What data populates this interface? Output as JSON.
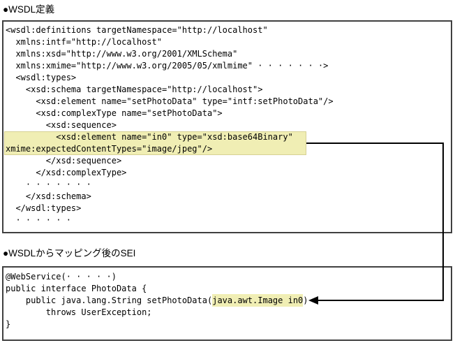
{
  "headings": {
    "wsdl": "●WSDL定義",
    "sei": "●WSDLからマッピング後のSEI"
  },
  "wsdl_box": {
    "lines": [
      "<wsdl:definitions targetNamespace=\"http://localhost\"",
      "  xmlns:intf=\"http://localhost\"",
      "  xmlns:xsd=\"http://www.w3.org/2001/XMLSchema\"",
      "  xmlns:xmime=\"http://www.w3.org/2005/05/xmlmime\" · · · · · · ·>",
      "  <wsdl:types>",
      "    <xsd:schema targetNamespace=\"http://localhost\">",
      "      <xsd:element name=\"setPhotoData\" type=\"intf:setPhotoData\"/>",
      "      <xsd:complexType name=\"setPhotoData\">",
      "        <xsd:sequence>",
      "          <xsd:element name=\"in0\" type=\"xsd:base64Binary\"",
      "xmime:expectedContentTypes=\"image/jpeg\"/>",
      "        </xsd:sequence>",
      "      </xsd:complexType>",
      "    · · · · · · ·",
      "    </xsd:schema>",
      "  </wsdl:types>",
      "  · · · · · ·"
    ]
  },
  "sei_box": {
    "line_webservice": "@WebService(· · · · ·)",
    "line_interface": "public interface PhotoData {",
    "sig_prefix": "    public java.lang.String setPhotoData(",
    "sig_highlight": "java.awt.Image in0",
    "sig_suffix": ")",
    "line_throws": "        throws UserException;",
    "line_close": "}"
  },
  "colors": {
    "highlight_fill": "#f0eeb4",
    "highlight_edge": "#d6d193",
    "box_border": "#404040",
    "connector": "#000000"
  }
}
